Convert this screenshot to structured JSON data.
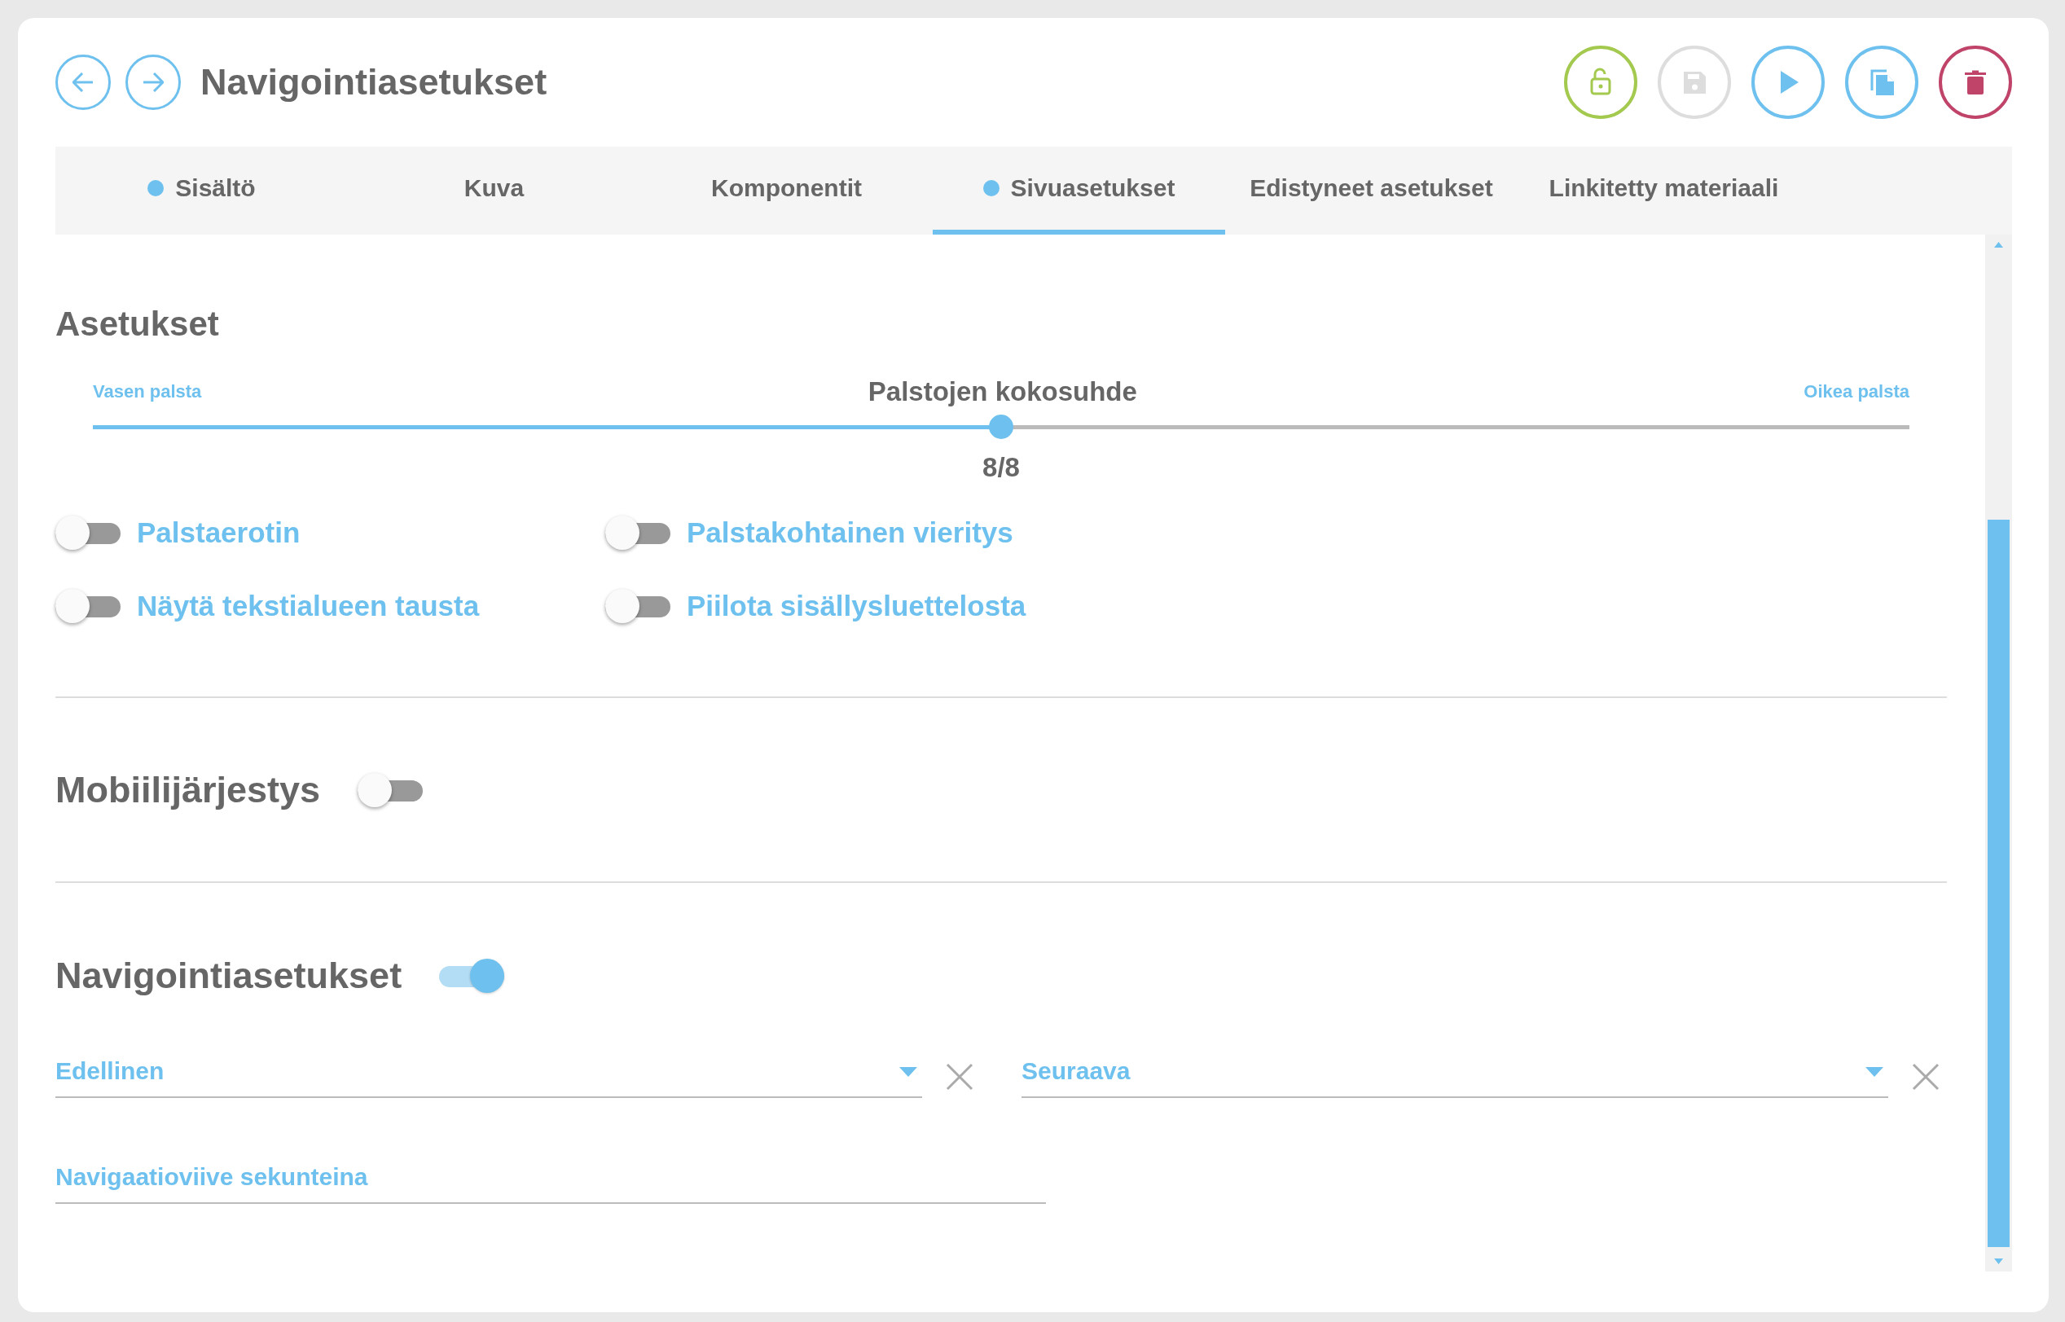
{
  "header": {
    "title": "Navigointiasetukset",
    "actions": [
      {
        "kind": "lock",
        "disabled": false
      },
      {
        "kind": "save",
        "disabled": true
      },
      {
        "kind": "play",
        "disabled": false
      },
      {
        "kind": "copy",
        "disabled": false
      },
      {
        "kind": "delete",
        "disabled": false
      }
    ]
  },
  "tabs": [
    {
      "label": "Sisältö",
      "dot": true,
      "selected": false
    },
    {
      "label": "Kuva",
      "dot": false,
      "selected": false
    },
    {
      "label": "Komponentit",
      "dot": false,
      "selected": false
    },
    {
      "label": "Sivuasetukset",
      "dot": true,
      "selected": true
    },
    {
      "label": "Edistyneet asetukset",
      "dot": false,
      "selected": false
    },
    {
      "label": "Linkitetty materiaali",
      "dot": false,
      "selected": false
    }
  ],
  "settings": {
    "heading": "Asetukset",
    "slider": {
      "left_label": "Vasen palsta",
      "title": "Palstojen kokosuhde",
      "right_label": "Oikea palsta",
      "level": 0.5,
      "reading": "8/8"
    },
    "toggles": [
      {
        "label": "Palstaerotin",
        "on": false
      },
      {
        "label": "Palstakohtainen vieritys",
        "on": false
      },
      {
        "label": "Näytä tekstialueen tausta",
        "on": false
      },
      {
        "label": "Piilota sisällysluettelosta",
        "on": false
      }
    ]
  },
  "mobile_order": {
    "heading": "Mobiilijärjestys",
    "on": false
  },
  "navigation": {
    "heading": "Navigointiasetukset",
    "on": true,
    "fields": [
      {
        "kind": "select",
        "placeholder": "Edellinen"
      },
      {
        "kind": "select",
        "placeholder": "Seuraava"
      },
      {
        "kind": "text",
        "placeholder": "Navigaatioviive sekunteina"
      }
    ]
  }
}
